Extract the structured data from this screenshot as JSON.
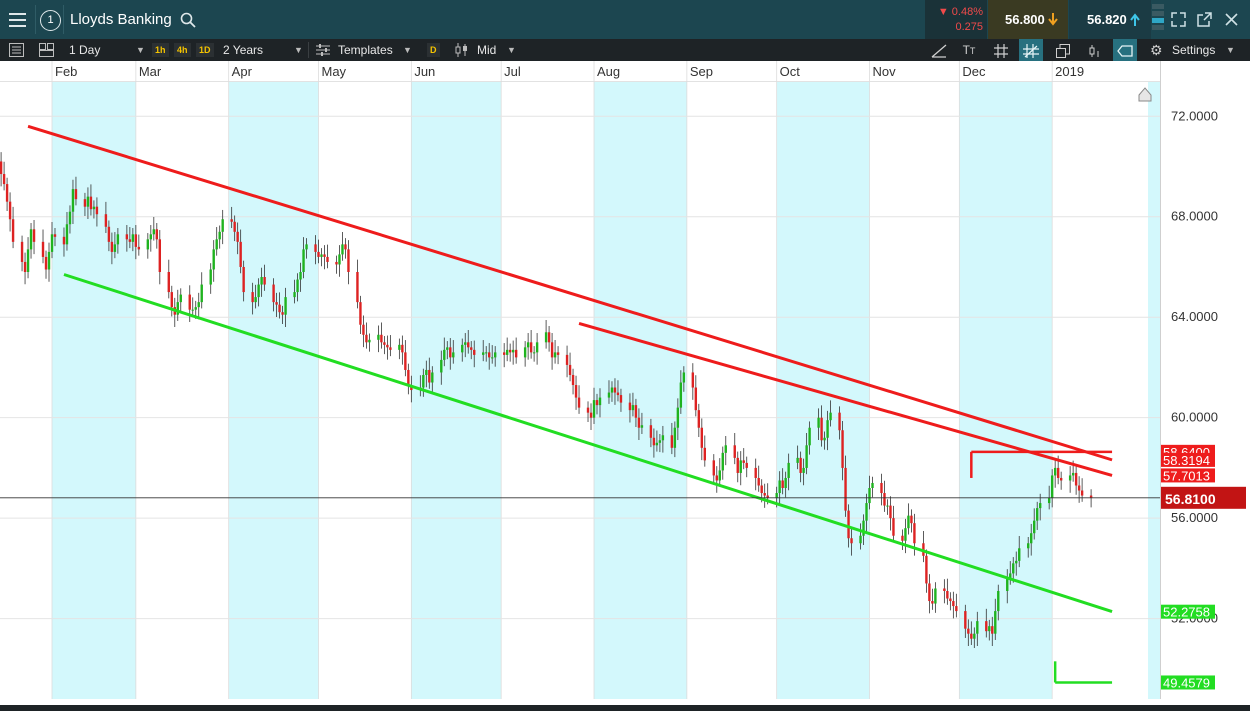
{
  "header": {
    "menu_icon": "hamburger-menu-icon",
    "number_icon": "circled-one-icon",
    "number_label": "1",
    "instrument": "Lloyds Banking",
    "search_icon": "search-icon",
    "change_pct": "▼ 0.48%",
    "change_abs": "0.275",
    "sell_price": "56.800",
    "buy_price": "56.820"
  },
  "toolbar": {
    "interval": "1 Day",
    "tf_1h": "1h",
    "tf_4h": "4h",
    "tf_1d": "1D",
    "range": "2 Years",
    "templates": "Templates",
    "d_badge": "D",
    "price_type": "Mid",
    "settings": "Settings"
  },
  "chart_data": {
    "type": "candlestick",
    "instrument": "Lloyds Banking",
    "months": [
      "Feb",
      "Mar",
      "Apr",
      "May",
      "Jun",
      "Jul",
      "Aug",
      "Sep",
      "Oct",
      "Nov",
      "Dec",
      "2019"
    ],
    "y_ticks": [
      "72.0000",
      "68.0000",
      "64.0000",
      "60.0000",
      "56.0000",
      "52.0000"
    ],
    "y_tick_values": [
      72,
      68,
      64,
      60,
      56,
      52
    ],
    "ylim": [
      48.8,
      74.2
    ],
    "current_price": "56.8100",
    "current_price_value": 56.81,
    "price_tags": [
      {
        "label": "58.6400",
        "value": 58.64,
        "color": "#ee1c1c"
      },
      {
        "label": "58.3194",
        "value": 58.3194,
        "color": "#ee1c1c"
      },
      {
        "label": "57.7013",
        "value": 57.7013,
        "color": "#ee1c1c"
      },
      {
        "label": "52.2758",
        "value": 52.2758,
        "color": "#22dd22"
      },
      {
        "label": "49.4579",
        "value": 49.4579,
        "color": "#22dd22"
      }
    ],
    "trendlines": [
      {
        "color": "#ee1c1c",
        "start_date": "2018-01-24",
        "start": 71.6,
        "end_date": "2019-01-21",
        "end": 58.32
      },
      {
        "color": "#ee1c1c",
        "start_date": "2018-07-27",
        "start": 63.75,
        "end_date": "2019-01-21",
        "end": 57.7
      },
      {
        "color": "#22dd22",
        "start_date": "2018-02-05",
        "start": 65.7,
        "end_date": "2019-01-21",
        "end": 52.28
      }
    ],
    "horizontal_lines": [
      {
        "color": "#ee1c1c",
        "value": 58.64,
        "from_date": "2018-12-05",
        "to_date": "2019-01-21"
      },
      {
        "color": "#22dd22",
        "value": 49.4579,
        "from_date": "2019-01-02",
        "to_date": "2019-01-21"
      }
    ],
    "closes": [
      70.2,
      70.6,
      70.9,
      71.3,
      71.5,
      71.2,
      70.9,
      71.0,
      70.6,
      70.2,
      69.7,
      69.3,
      68.6,
      67.9,
      67.0,
      66.2,
      65.8,
      66.7,
      67.5,
      67.0,
      66.4,
      65.9,
      66.6,
      67.3,
      67.2,
      66.9,
      67.7,
      68.2,
      69.1,
      68.7,
      68.4,
      68.8,
      68.3,
      68.4,
      68.1,
      67.6,
      67.0,
      66.6,
      66.9,
      67.3,
      67.1,
      67.0,
      67.3,
      66.8,
      66.7,
      67.1,
      67.3,
      67.5,
      67.1,
      65.8,
      65.0,
      64.4,
      64.1,
      64.6,
      64.9,
      64.3,
      64.3,
      64.4,
      64.6,
      65.3,
      65.9,
      66.7,
      67.1,
      67.4,
      67.9,
      67.8,
      67.4,
      67.0,
      66.0,
      65.0,
      64.6,
      64.8,
      65.3,
      65.6,
      65.3,
      64.6,
      64.5,
      64.2,
      64.1,
      64.8,
      65.0,
      65.5,
      65.8,
      66.7,
      66.9,
      66.6,
      66.4,
      66.5,
      66.4,
      66.2,
      66.1,
      66.5,
      66.9,
      66.7,
      65.8,
      64.6,
      63.7,
      63.3,
      63.0,
      63.1,
      63.3,
      63.0,
      62.9,
      62.8,
      62.7,
      62.9,
      62.6,
      61.9,
      61.3,
      61.1,
      61.2,
      61.7,
      61.9,
      61.4,
      61.8,
      62.3,
      62.7,
      62.8,
      62.4,
      62.6,
      62.9,
      63.0,
      62.8,
      62.7,
      62.5,
      62.6,
      62.6,
      62.4,
      62.4,
      62.6,
      62.5,
      62.7,
      62.6,
      62.7,
      62.4,
      62.8,
      63.0,
      62.6,
      62.6,
      63.0,
      63.4,
      63.0,
      62.4,
      62.6,
      62.5,
      62.1,
      61.7,
      61.3,
      60.8,
      60.4,
      60.2,
      60.0,
      60.7,
      60.5,
      60.8,
      61.0,
      61.2,
      61.0,
      60.9,
      60.6,
      60.3,
      60.5,
      60.0,
      59.6,
      59.7,
      59.2,
      58.9,
      59.0,
      59.1,
      59.3,
      58.8,
      59.6,
      60.4,
      61.4,
      61.8,
      61.2,
      60.3,
      59.6,
      58.8,
      58.3,
      57.7,
      57.5,
      57.9,
      58.6,
      58.9,
      58.4,
      57.8,
      58.3,
      58.2,
      58.0,
      57.6,
      57.3,
      57.0,
      56.9,
      56.8,
      57.0,
      57.5,
      57.2,
      57.6,
      58.2,
      58.4,
      57.8,
      58.0,
      58.9,
      59.6,
      60.0,
      59.1,
      59.2,
      59.9,
      60.2,
      59.5,
      58.0,
      56.3,
      55.2,
      55.0,
      55.3,
      55.9,
      56.6,
      57.2,
      57.4,
      57.0,
      56.5,
      56.5,
      56.0,
      55.3,
      55.1,
      55.6,
      56.1,
      55.8,
      55.0,
      54.5,
      53.4,
      52.7,
      52.6,
      53.2,
      53.1,
      52.8,
      52.7,
      52.5,
      52.3,
      51.6,
      51.4,
      51.2,
      51.4,
      51.9,
      51.5,
      51.7,
      51.4,
      52.3,
      53.1,
      53.6,
      53.8,
      54.2,
      54.3,
      54.8,
      55.0,
      55.4,
      55.9,
      56.4,
      56.6,
      56.8,
      57.7,
      58.0,
      57.6,
      57.5,
      57.7,
      57.8,
      57.3,
      57.1,
      56.9,
      56.8
    ]
  }
}
